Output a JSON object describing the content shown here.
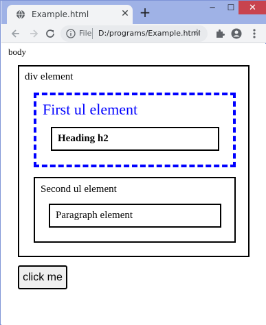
{
  "browser": {
    "tab": {
      "title": "Example.html",
      "close_glyph": "✕",
      "icon": "globe-icon"
    },
    "new_tab_glyph": "+",
    "window_controls": {
      "minimize": "─",
      "maximize": "☐",
      "close": "✕"
    },
    "address": {
      "scheme": "File",
      "url": "D:/programs/Example.html"
    }
  },
  "page": {
    "body_label": "body",
    "div_label": "div element",
    "first_ul": {
      "label": "First ul element",
      "heading": "Heading h2",
      "border_color": "#0000ff"
    },
    "second_ul": {
      "label": "Second ul element",
      "paragraph": "Paragraph element"
    },
    "button_label": "click me"
  },
  "colors": {
    "frame": "#9fb2e6",
    "toolbar": "#f2f3f5",
    "close_button": "#c8434e",
    "dashed_border": "#0000ff"
  }
}
